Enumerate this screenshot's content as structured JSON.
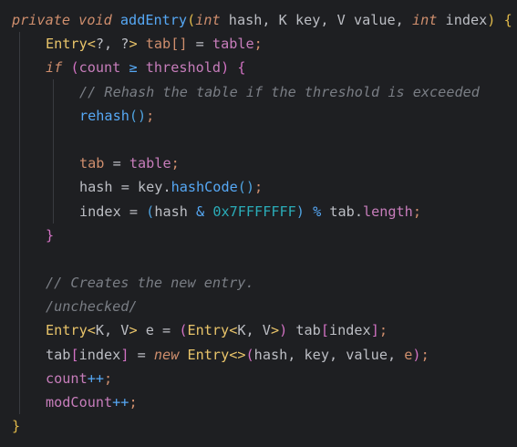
{
  "editor": {
    "language": "java",
    "theme_colors": {
      "background": "#1e1f22",
      "default_text": "#bcbec4",
      "keyword": "#cf8e6d",
      "method": "#56a8f5",
      "field": "#c77dbb",
      "comment": "#7a7e85",
      "number": "#2aacb8"
    },
    "lines": [
      {
        "indent": 0,
        "tokens": [
          {
            "t": "private",
            "c": "kwi"
          },
          {
            "t": " "
          },
          {
            "t": "void",
            "c": "kwi"
          },
          {
            "t": " "
          },
          {
            "t": "addEntry",
            "c": "fn"
          },
          {
            "t": "(",
            "c": "br1"
          },
          {
            "t": "int",
            "c": "kwi"
          },
          {
            "t": " hash, K key, V value, "
          },
          {
            "t": "int",
            "c": "kwi"
          },
          {
            "t": " index"
          },
          {
            "t": ")",
            "c": "br1"
          },
          {
            "t": " "
          },
          {
            "t": "{",
            "c": "br1"
          }
        ]
      },
      {
        "indent": 1,
        "tokens": [
          {
            "t": "Entry",
            "c": "ty"
          },
          {
            "t": "<",
            "c": "ty"
          },
          {
            "t": "?, ?"
          },
          {
            "t": ">",
            "c": "ty"
          },
          {
            "t": " tab",
            "c": "kw"
          },
          {
            "t": "[]",
            "c": "kw"
          },
          {
            "t": " = "
          },
          {
            "t": "table",
            "c": "fld"
          },
          {
            "t": ";",
            "c": "kw"
          }
        ]
      },
      {
        "indent": 1,
        "tokens": [
          {
            "t": "if",
            "c": "kwi"
          },
          {
            "t": " "
          },
          {
            "t": "(",
            "c": "br2"
          },
          {
            "t": "count",
            "c": "fld"
          },
          {
            "t": " ≥ ",
            "c": "op"
          },
          {
            "t": "threshold",
            "c": "fld"
          },
          {
            "t": ")",
            "c": "br2"
          },
          {
            "t": " "
          },
          {
            "t": "{",
            "c": "br2"
          }
        ]
      },
      {
        "indent": 2,
        "tokens": [
          {
            "t": "// Rehash the table if the threshold is exceeded",
            "c": "cmt"
          }
        ]
      },
      {
        "indent": 2,
        "tokens": [
          {
            "t": "rehash",
            "c": "fn"
          },
          {
            "t": "()",
            "c": "br3"
          },
          {
            "t": ";",
            "c": "kw"
          }
        ]
      },
      {
        "indent": 2,
        "tokens": []
      },
      {
        "indent": 2,
        "tokens": [
          {
            "t": "tab",
            "c": "kw"
          },
          {
            "t": " = "
          },
          {
            "t": "table",
            "c": "fld"
          },
          {
            "t": ";",
            "c": "kw"
          }
        ]
      },
      {
        "indent": 2,
        "tokens": [
          {
            "t": "hash"
          },
          {
            "t": " = "
          },
          {
            "t": "key."
          },
          {
            "t": "hashCode",
            "c": "fn"
          },
          {
            "t": "()",
            "c": "br3"
          },
          {
            "t": ";",
            "c": "kw"
          }
        ]
      },
      {
        "indent": 2,
        "tokens": [
          {
            "t": "index"
          },
          {
            "t": " = "
          },
          {
            "t": "(",
            "c": "br3"
          },
          {
            "t": "hash "
          },
          {
            "t": "&",
            "c": "op"
          },
          {
            "t": " "
          },
          {
            "t": "0x7FFFFFFF",
            "c": "num"
          },
          {
            "t": ")",
            "c": "br3"
          },
          {
            "t": " "
          },
          {
            "t": "%",
            "c": "op"
          },
          {
            "t": " tab."
          },
          {
            "t": "length",
            "c": "fld"
          },
          {
            "t": ";",
            "c": "kw"
          }
        ]
      },
      {
        "indent": 1,
        "tokens": [
          {
            "t": "}",
            "c": "br2"
          }
        ]
      },
      {
        "indent": 1,
        "tokens": []
      },
      {
        "indent": 1,
        "tokens": [
          {
            "t": "// Creates the new entry.",
            "c": "cmt"
          }
        ]
      },
      {
        "indent": 1,
        "tokens": [
          {
            "t": "/unchecked/",
            "c": "cmt"
          }
        ]
      },
      {
        "indent": 1,
        "tokens": [
          {
            "t": "Entry",
            "c": "ty"
          },
          {
            "t": "<",
            "c": "ty"
          },
          {
            "t": "K, V"
          },
          {
            "t": ">",
            "c": "ty"
          },
          {
            "t": " e = "
          },
          {
            "t": "(",
            "c": "br2"
          },
          {
            "t": "Entry",
            "c": "ty"
          },
          {
            "t": "<",
            "c": "ty"
          },
          {
            "t": "K, V"
          },
          {
            "t": ">",
            "c": "ty"
          },
          {
            "t": ")",
            "c": "br2"
          },
          {
            "t": " tab"
          },
          {
            "t": "[",
            "c": "br2"
          },
          {
            "t": "index"
          },
          {
            "t": "]",
            "c": "br2"
          },
          {
            "t": ";",
            "c": "kw"
          }
        ]
      },
      {
        "indent": 1,
        "tokens": [
          {
            "t": "tab"
          },
          {
            "t": "[",
            "c": "br2"
          },
          {
            "t": "index"
          },
          {
            "t": "]",
            "c": "br2"
          },
          {
            "t": " = "
          },
          {
            "t": "new",
            "c": "kwi"
          },
          {
            "t": " "
          },
          {
            "t": "Entry",
            "c": "ty"
          },
          {
            "t": "<>",
            "c": "ty"
          },
          {
            "t": "(",
            "c": "br2"
          },
          {
            "t": "hash, key, value, "
          },
          {
            "t": "e",
            "c": "kw"
          },
          {
            "t": ")",
            "c": "br2"
          },
          {
            "t": ";",
            "c": "kw"
          }
        ]
      },
      {
        "indent": 1,
        "tokens": [
          {
            "t": "count",
            "c": "fld"
          },
          {
            "t": "++",
            "c": "op"
          },
          {
            "t": ";",
            "c": "kw"
          }
        ]
      },
      {
        "indent": 1,
        "tokens": [
          {
            "t": "modCount",
            "c": "fld"
          },
          {
            "t": "++",
            "c": "op"
          },
          {
            "t": ";",
            "c": "kw"
          }
        ]
      },
      {
        "indent": 0,
        "tokens": [
          {
            "t": "}",
            "c": "br1"
          }
        ]
      }
    ]
  }
}
